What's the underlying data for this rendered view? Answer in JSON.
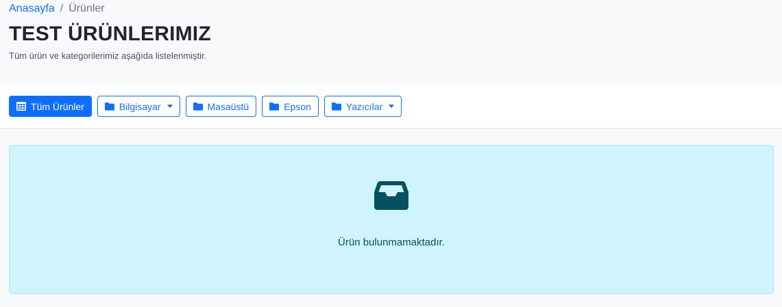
{
  "breadcrumb": {
    "home": "Anasayfa",
    "separator": "/",
    "current": "Ürünler"
  },
  "page": {
    "title": "TEST ÜRÜNLERIMIZ",
    "subtitle": "Tüm ürün ve kategorilerimiz aşağıda listelenmiştir."
  },
  "toolbar": {
    "buttons": [
      {
        "label": "Tüm Ürünler",
        "icon": "grid-icon",
        "active": true,
        "dropdown": false
      },
      {
        "label": "Bilgisayar",
        "icon": "folder-icon",
        "active": false,
        "dropdown": true
      },
      {
        "label": "Masaüstü",
        "icon": "folder-icon",
        "active": false,
        "dropdown": false
      },
      {
        "label": "Epson",
        "icon": "folder-icon",
        "active": false,
        "dropdown": false
      },
      {
        "label": "Yazıcılar",
        "icon": "folder-icon",
        "active": false,
        "dropdown": true
      }
    ]
  },
  "empty_state": {
    "icon": "inbox-icon",
    "message": "Ürün bulunmamaktadır."
  },
  "colors": {
    "primary": "#0d6efd",
    "info_bg": "#cff4fc",
    "info_border": "#9eeaf9",
    "info_text": "#055160",
    "page_bg": "#f8f9fa"
  }
}
